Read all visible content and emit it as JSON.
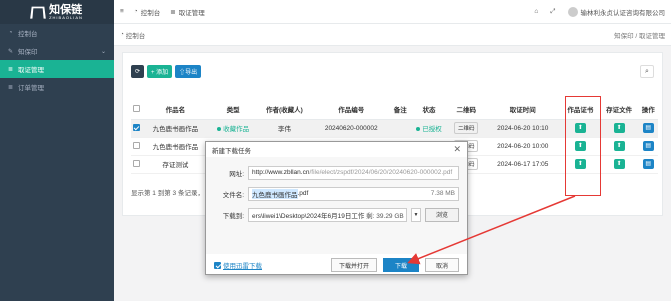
{
  "brand": {
    "name": "知保链",
    "sub": "ZHIBAOLIAN"
  },
  "sidebar": {
    "items": [
      {
        "label": "控制台",
        "icon": "dashboard-icon"
      },
      {
        "label": "知保印",
        "icon": "stamp-icon",
        "chevron": "⌄"
      },
      {
        "label": "取证管理",
        "icon": "list-icon",
        "active": true
      },
      {
        "label": "订单管理",
        "icon": "list-icon"
      }
    ]
  },
  "topbar": {
    "menu_icon": "≡",
    "tabs": [
      {
        "label": "控制台"
      },
      {
        "label": "取证管理"
      }
    ],
    "company": "输林利永贞认证咨询有限公司"
  },
  "breadcrumb": {
    "left": "控制台",
    "right": "知保印 / 取证管理"
  },
  "toolbar": {
    "refresh": "⟳",
    "add": "+ 添加",
    "export": "⇧导出",
    "search": "⌕"
  },
  "table": {
    "headers": [
      "",
      "作品名",
      "类型",
      "作者(收藏人)",
      "作品编号",
      "备注",
      "状态",
      "二维码",
      "取证时间",
      "作品证书",
      "存证文件",
      "操作"
    ],
    "rows": [
      {
        "checked": true,
        "name": "九色鹿书画作品",
        "type": "收藏作品",
        "author": "李伟",
        "code": "20240620-000002",
        "note": "",
        "status": "已授权",
        "qr": "二维码",
        "time": "2024-06-20 10:10"
      },
      {
        "checked": false,
        "name": "九色鹿书画作品",
        "type": "",
        "author": "",
        "code": "",
        "note": "",
        "status": "",
        "qr": "二维码",
        "time": "2024-06-20 10:00"
      },
      {
        "checked": false,
        "name": "存证测试",
        "type": "",
        "author": "",
        "code": "",
        "note": "",
        "status": "",
        "qr": "二维码",
        "time": "2024-06-17 17:05"
      }
    ],
    "page_info": "显示第 1 到第 3 条记录，"
  },
  "dialog": {
    "title": "新建下载任务",
    "url_label": "网址:",
    "url_host": "http://www.zbllan.cn",
    "url_rest": "/file/elect/zspdf/2024/06/20/20240620-000002.pdf",
    "name_label": "文件名:",
    "name_selected": "九色鹿书画作品",
    "name_ext": ".pdf",
    "size": "7.38 MB",
    "dir_label": "下载到:",
    "dir_path": "ers\\liwei1\\Desktop\\2024年6月19日工作",
    "dir_free": "剩: 39.29 GB",
    "browse": "浏览",
    "xunlei": "使用迅雷下载",
    "btn_download_open": "下载并打开",
    "btn_download": "下载",
    "btn_cancel": "取消"
  }
}
